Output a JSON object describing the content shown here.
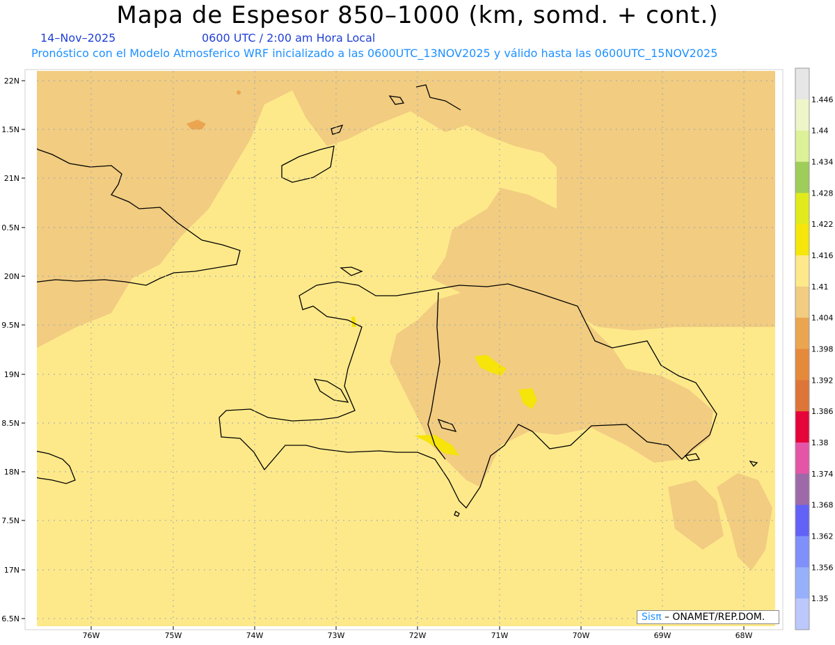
{
  "header": {
    "title": "Mapa de Espesor 850–1000 (km, somd. + cont.)",
    "date": "14–Nov–2025",
    "time": "0600 UTC / 2:00 am Hora Local",
    "description": "Pronóstico con el Modelo Atmosferico WRF inicializado a las 0600UTC_13NOV2025 y válido hasta las  0600UTC_15NOV2025"
  },
  "map": {
    "lat_labels": [
      "22N",
      "1.5N",
      "21N",
      "0.5N",
      "20N",
      "9.5N",
      "19N",
      "8.5N",
      "18N",
      "7.5N",
      "17N",
      "6.5N"
    ],
    "lon_labels": [
      "76W",
      "75W",
      "74W",
      "73W",
      "72W",
      "71W",
      "70W",
      "69W",
      "68W"
    ],
    "colors": {
      "ocean_low": "#f1cc81",
      "mid": "#fee98a",
      "high": "#f6e40a",
      "orange": "#eba551",
      "coast": "#000000"
    }
  },
  "colorbar": {
    "labels": [
      "1.446",
      "1.44",
      "1.434",
      "1.428",
      "1.422",
      "1.416",
      "1.41",
      "1.404",
      "1.398",
      "1.392",
      "1.386",
      "1.38",
      "1.374",
      "1.368",
      "1.362",
      "1.356",
      "1.35"
    ],
    "colors": [
      "#e6e6e6",
      "#eef5c8",
      "#dcf198",
      "#9fcd5a",
      "#e1eb1c",
      "#f6e60a",
      "#fee98a",
      "#f1cc81",
      "#eba551",
      "#e5893b",
      "#dd7438",
      "#e5053a",
      "#e455a7",
      "#9e69a9",
      "#6262f6",
      "#8090fb",
      "#97b0fb",
      "#bcc8fb"
    ]
  },
  "credit": {
    "brand": "Sisπ",
    "text": " – ONAMET/REP.DOM."
  }
}
